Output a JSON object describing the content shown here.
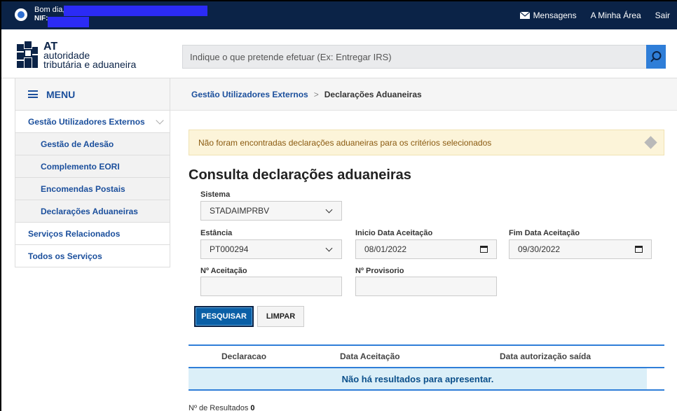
{
  "topbar": {
    "greeting": "Bom dia,",
    "nif_label": "NIF:",
    "links": {
      "messages": "Mensagens",
      "my_area": "A Minha Área",
      "logout": "Sair"
    }
  },
  "header": {
    "logo_big": "AT",
    "logo_line1": "autoridade",
    "logo_line2": "tributária e aduaneira",
    "search_placeholder": "Indique o que pretende efetuar (Ex: Entregar IRS)"
  },
  "sidebar": {
    "menu_label": "MENU",
    "items": [
      {
        "label": "Gestão Utilizadores Externos",
        "type": "group"
      },
      {
        "label": "Gestão de Adesão",
        "type": "sub"
      },
      {
        "label": "Complemento EORI",
        "type": "sub"
      },
      {
        "label": "Encomendas Postais",
        "type": "sub"
      },
      {
        "label": "Declarações Aduaneiras",
        "type": "sub"
      },
      {
        "label": "Serviços Relacionados",
        "type": "top"
      },
      {
        "label": "Todos os Serviços",
        "type": "top"
      }
    ]
  },
  "breadcrumb": {
    "parent": "Gestão Utilizadores Externos",
    "separator": ">",
    "current": "Declarações Aduaneiras"
  },
  "alert": {
    "text": "Não foram encontradas declarações aduaneiras para os critérios selecionados"
  },
  "page_title": "Consulta declarações aduaneiras",
  "form": {
    "sistema": {
      "label": "Sistema",
      "value": "STADAIMPRBV"
    },
    "estancia": {
      "label": "Estância",
      "value": "PT000294"
    },
    "inicio": {
      "label": "Inicio Data Aceitação",
      "value": "08/01/2022"
    },
    "fim": {
      "label": "Fim Data Aceitação",
      "value": "09/30/2022"
    },
    "n_aceitacao": {
      "label": "Nº Aceitação",
      "value": ""
    },
    "n_provisorio": {
      "label": "Nº Provisorio",
      "value": ""
    },
    "search_button": "PESQUISAR",
    "clear_button": "LIMPAR"
  },
  "table": {
    "columns": [
      "Declaracao",
      "Data Aceitação",
      "Data autorização saída"
    ],
    "empty_message": "Não há resultados para apresentar."
  },
  "results": {
    "label": "Nº de Resultados",
    "count": "0"
  },
  "colors": {
    "navy": "#0b2347",
    "primary": "#0a5fa6",
    "link": "#1b4f9c",
    "accent": "#2f7ed8"
  }
}
